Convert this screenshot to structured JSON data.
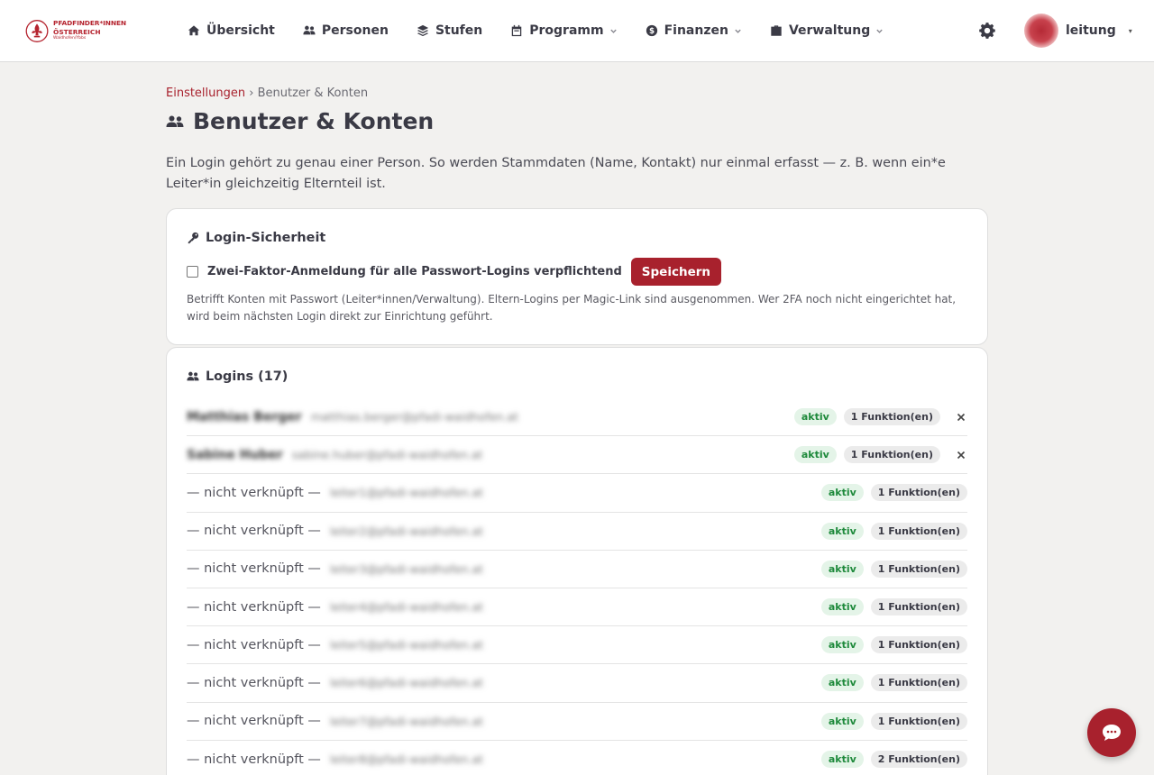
{
  "brand": {
    "line1": "PFADFINDER*INNEN",
    "line2": "ÖSTERREICH",
    "line3": "Waldhofen/Ybbs"
  },
  "nav": {
    "items": [
      {
        "label": "Übersicht",
        "icon": "home-icon"
      },
      {
        "label": "Personen",
        "icon": "users-icon"
      },
      {
        "label": "Stufen",
        "icon": "layers-icon"
      },
      {
        "label": "Programm",
        "icon": "calendar-icon",
        "dropdown": true
      },
      {
        "label": "Finanzen",
        "icon": "dollar-icon",
        "dropdown": true
      },
      {
        "label": "Verwaltung",
        "icon": "briefcase-icon",
        "dropdown": true
      }
    ]
  },
  "user": {
    "name": "leitung",
    "caret": "▾"
  },
  "breadcrumb": {
    "parent": "Einstellungen",
    "separator": "›",
    "current": "Benutzer & Konten"
  },
  "page": {
    "title": "Benutzer & Konten",
    "intro": "Ein Login gehört zu genau einer Person. So werden Stammdaten (Name, Kontakt) nur einmal erfasst — z. B. wenn ein*e Leiter*in gleichzeitig Elternteil ist."
  },
  "security": {
    "title": "Login-Sicherheit",
    "mfa_label": "Zwei-Faktor-Anmeldung für alle Passwort-Logins verpflichtend",
    "mfa_checked": false,
    "save_label": "Speichern",
    "help": "Betrifft Konten mit Passwort (Leiter*innen/Verwaltung). Eltern-Logins per Magic-Link sind ausgenommen. Wer 2FA noch nicht eingerichtet hat, wird beim nächsten Login direkt zur Einrichtung geführt."
  },
  "logins": {
    "title": "Logins (17)",
    "rows": [
      {
        "person": "Matthias Berger",
        "email": "matthias.berger@pfadi-waidhofen.at",
        "linked": true,
        "status": "aktiv",
        "functions": "1 Funktion(en)"
      },
      {
        "person": "Sabine Huber",
        "email": "sabine.huber@pfadi-waidhofen.at",
        "linked": true,
        "status": "aktiv",
        "functions": "1 Funktion(en)"
      },
      {
        "person": "— nicht verknüpft —",
        "email": "leiter1@pfadi-waidhofen.at",
        "linked": false,
        "status": "aktiv",
        "functions": "1 Funktion(en)"
      },
      {
        "person": "— nicht verknüpft —",
        "email": "leiter2@pfadi-waidhofen.at",
        "linked": false,
        "status": "aktiv",
        "functions": "1 Funktion(en)"
      },
      {
        "person": "— nicht verknüpft —",
        "email": "leiter3@pfadi-waidhofen.at",
        "linked": false,
        "status": "aktiv",
        "functions": "1 Funktion(en)"
      },
      {
        "person": "— nicht verknüpft —",
        "email": "leiter4@pfadi-waidhofen.at",
        "linked": false,
        "status": "aktiv",
        "functions": "1 Funktion(en)"
      },
      {
        "person": "— nicht verknüpft —",
        "email": "leiter5@pfadi-waidhofen.at",
        "linked": false,
        "status": "aktiv",
        "functions": "1 Funktion(en)"
      },
      {
        "person": "— nicht verknüpft —",
        "email": "leiter6@pfadi-waidhofen.at",
        "linked": false,
        "status": "aktiv",
        "functions": "1 Funktion(en)"
      },
      {
        "person": "— nicht verknüpft —",
        "email": "leiter7@pfadi-waidhofen.at",
        "linked": false,
        "status": "aktiv",
        "functions": "1 Funktion(en)"
      },
      {
        "person": "— nicht verknüpft —",
        "email": "leiter8@pfadi-waidhofen.at",
        "linked": false,
        "status": "aktiv",
        "functions": "2 Funktion(en)"
      }
    ]
  },
  "colors": {
    "brand": "#a8212d",
    "active": "#1f8a3c",
    "background": "#f2f1ef"
  },
  "icons": {
    "settings": "gear-icon",
    "chat": "chat-bubble-icon",
    "unlink": "close-icon"
  }
}
